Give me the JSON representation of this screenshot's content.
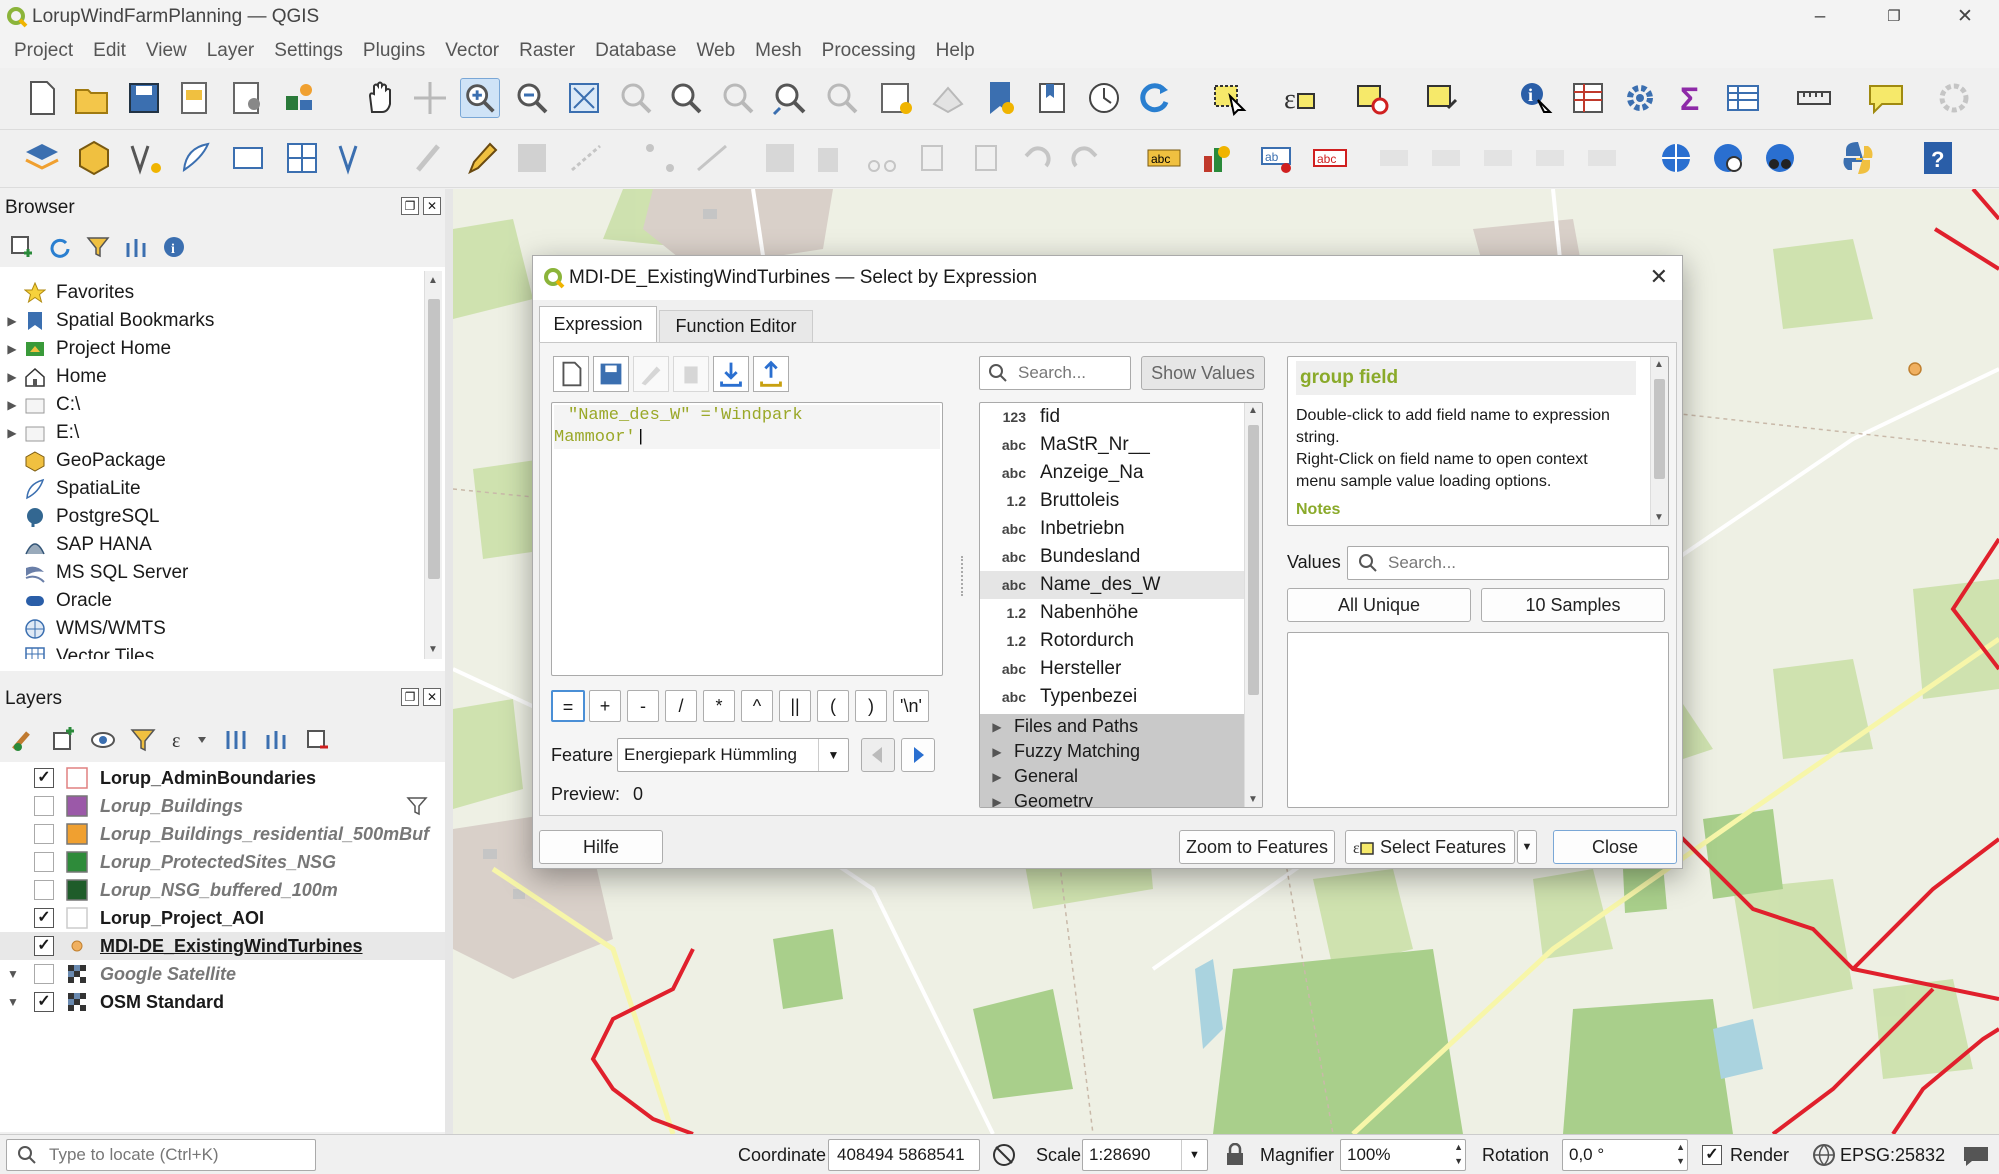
{
  "window": {
    "title": "LorupWindFarmPlanning — QGIS",
    "controls": [
      "–",
      "❐",
      "✕"
    ]
  },
  "menu": [
    "Project",
    "Edit",
    "View",
    "Layer",
    "Settings",
    "Plugins",
    "Vector",
    "Raster",
    "Database",
    "Web",
    "Mesh",
    "Processing",
    "Help"
  ],
  "browser": {
    "title": "Browser",
    "items": [
      {
        "label": "Favorites",
        "icon": "star-icon",
        "arrow": ""
      },
      {
        "label": "Spatial Bookmarks",
        "icon": "bookmark-icon",
        "arrow": "▶"
      },
      {
        "label": "Project Home",
        "icon": "project-home-icon",
        "arrow": "▶"
      },
      {
        "label": "Home",
        "icon": "home-icon",
        "arrow": "▶"
      },
      {
        "label": "C:\\",
        "icon": "drive-icon",
        "arrow": "▶"
      },
      {
        "label": "E:\\",
        "icon": "drive-icon",
        "arrow": "▶"
      },
      {
        "label": "GeoPackage",
        "icon": "geopackage-icon",
        "arrow": ""
      },
      {
        "label": "SpatiaLite",
        "icon": "spatialite-icon",
        "arrow": ""
      },
      {
        "label": "PostgreSQL",
        "icon": "postgresql-icon",
        "arrow": ""
      },
      {
        "label": "SAP HANA",
        "icon": "sap-hana-icon",
        "arrow": ""
      },
      {
        "label": "MS SQL Server",
        "icon": "mssql-icon",
        "arrow": ""
      },
      {
        "label": "Oracle",
        "icon": "oracle-icon",
        "arrow": ""
      },
      {
        "label": "WMS/WMTS",
        "icon": "wms-icon",
        "arrow": ""
      },
      {
        "label": "Vector Tiles",
        "icon": "vector-tiles-icon",
        "arrow": ""
      }
    ]
  },
  "layers": {
    "title": "Layers",
    "items": [
      {
        "name": "Lorup_AdminBoundaries",
        "checked": true,
        "style": "bold",
        "symbol": "#ffffff",
        "symbol_border": "#e08080",
        "arrow": ""
      },
      {
        "name": "Lorup_Buildings",
        "checked": false,
        "style": "italic",
        "symbol": "#9b59a8",
        "filter": true,
        "arrow": ""
      },
      {
        "name": "Lorup_Buildings_residential_500mBuf",
        "checked": false,
        "style": "italic",
        "symbol": "#f0a030",
        "arrow": ""
      },
      {
        "name": "Lorup_ProtectedSites_NSG",
        "checked": false,
        "style": "italic",
        "symbol": "#2e8b3a",
        "arrow": ""
      },
      {
        "name": "Lorup_NSG_buffered_100m",
        "checked": false,
        "style": "italic",
        "symbol": "#1f5c2a",
        "arrow": ""
      },
      {
        "name": "Lorup_Project_AOI",
        "checked": true,
        "style": "bold",
        "symbol": "#ffffff",
        "symbol_border": "#cccccc",
        "arrow": ""
      },
      {
        "name": "MDI-DE_ExistingWindTurbines",
        "checked": true,
        "style": "boldunder",
        "symbol": "point",
        "arrow": ""
      },
      {
        "name": "Google Satellite",
        "checked": false,
        "style": "italic",
        "symbol": "raster",
        "arrow": "▼"
      },
      {
        "name": "OSM Standard",
        "checked": true,
        "style": "bold",
        "symbol": "raster",
        "arrow": "▼"
      }
    ]
  },
  "dialog": {
    "title": "MDI-DE_ExistingWindTurbines — Select by Expression",
    "tabs": [
      "Expression",
      "Function Editor"
    ],
    "expression_line1": "\"Name_des_W\" ='Windpark",
    "expression_line2": "Mammoor'",
    "operators": [
      "=",
      "+",
      "-",
      "/",
      "*",
      "^",
      "||",
      "(",
      ")",
      "'\\n'"
    ],
    "feature_label": "Feature",
    "feature_value": "Energiepark Hümmling",
    "preview_label": "Preview:",
    "preview_value": "0",
    "search_placeholder": "Search...",
    "show_values": "Show Values",
    "fields": [
      {
        "type": "123",
        "name": "fid"
      },
      {
        "type": "abc",
        "name": "MaStR_Nr__"
      },
      {
        "type": "abc",
        "name": "Anzeige_Na"
      },
      {
        "type": "1.2",
        "name": "Bruttoleis"
      },
      {
        "type": "abc",
        "name": "Inbetriebn"
      },
      {
        "type": "abc",
        "name": "Bundesland"
      },
      {
        "type": "abc",
        "name": "Name_des_W",
        "selected": true
      },
      {
        "type": "1.2",
        "name": "Nabenhöhe"
      },
      {
        "type": "1.2",
        "name": "Rotordurch"
      },
      {
        "type": "abc",
        "name": "Hersteller"
      },
      {
        "type": "abc",
        "name": "Typenbezei"
      }
    ],
    "groups": [
      "Files and Paths",
      "Fuzzy Matching",
      "General",
      "Geometry"
    ],
    "help_title": "group field",
    "help_text1": "Double-click to add field name to expression string.",
    "help_text2": "Right-Click on field name to open context menu sample value loading options.",
    "help_notes": "Notes",
    "values_label": "Values",
    "values_search": "Search...",
    "all_unique": "All Unique",
    "ten_samples": "10 Samples",
    "hilfe": "Hilfe",
    "zoom": "Zoom to Features",
    "select": "Select Features",
    "close": "Close"
  },
  "status": {
    "locate_placeholder": "Type to locate (Ctrl+K)",
    "coordinate_label": "Coordinate",
    "coordinate_value": "408494  5868541",
    "scale_label": "Scale",
    "scale_value": "1:28690",
    "magnifier_label": "Magnifier",
    "magnifier_value": "100%",
    "rotation_label": "Rotation",
    "rotation_value": "0,0 °",
    "render_label": "Render",
    "crs": "EPSG:25832"
  },
  "colors": {
    "accent": "#4a8fd6",
    "boundary": "#e0202c",
    "qgis_green": "#8bb43a",
    "help_title": "#8aaa2a"
  }
}
